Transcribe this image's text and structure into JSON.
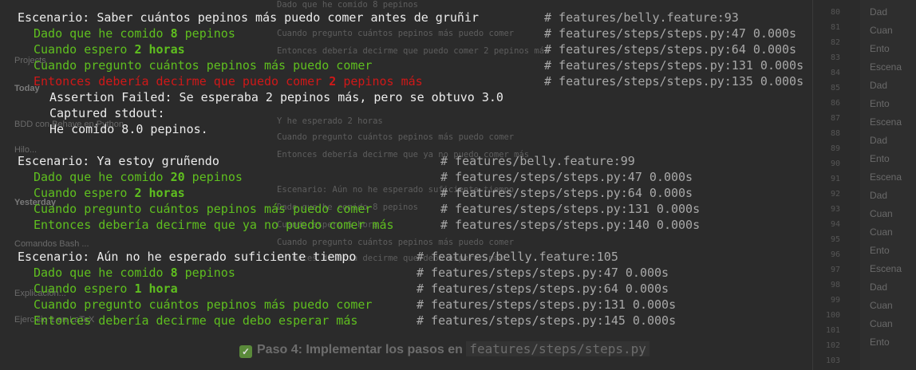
{
  "background": {
    "left_panel": [
      {
        "text": "Projects",
        "bold": false
      },
      {
        "text": "Today",
        "bold": true
      },
      {
        "text": "BDD con Behave en Python",
        "bold": false
      },
      {
        "text": "Hilo...",
        "bold": false
      },
      {
        "text": "Yesterday",
        "bold": true
      },
      {
        "text": "Comandos Bash ...",
        "bold": false
      },
      {
        "text": "Explicación...",
        "bold": false
      },
      {
        "text": "Ejercicio 1 en LaTeX",
        "bold": false
      }
    ],
    "center_lines": [
      "Dado que he comido 8 pepinos",
      "Cuando pregunto cuántos pepinos más puedo comer",
      "Entonces debería decirme que puedo comer 2 pepinos más",
      "Y he esperado 2 horas",
      "Cuando pregunto cuántos pepinos más puedo comer",
      "Entonces debería decirme que ya no puedo comer más",
      "Escenario: Aún no he esperado suficiente tiempo",
      "Dado que he comido 8 pepinos",
      "Cuando espero 1 hora",
      "Cuando pregunto cuántos pepinos más puedo comer",
      "Entonces debería decirme que debo esperar más"
    ],
    "gutter_numbers": [
      "80",
      "81",
      "82",
      "83",
      "84",
      "85",
      "86",
      "87",
      "88",
      "89",
      "90",
      "91",
      "92",
      "93",
      "94",
      "95",
      "96",
      "97",
      "98",
      "99",
      "100",
      "101",
      "102",
      "103"
    ],
    "right_panel": [
      "Dad",
      "Cuan",
      "Ento",
      "Escena",
      "Dad",
      "Ento",
      "Escena",
      "Dad",
      "Ento",
      "Escena",
      "Dad",
      "Cuan",
      "Cuan",
      "Ento",
      "Escena",
      "Dad",
      "Cuan",
      "Cuan",
      "Ento"
    ],
    "heading": {
      "prefix": "Paso 4: Implementar los pasos en ",
      "code": "features/steps/steps.py"
    }
  },
  "scenarios": [
    {
      "title": "Escenario: Saber cuántos pepinos más puedo comer antes de gruñir",
      "location": "# features/belly.feature:93",
      "comment_col": 660,
      "steps": [
        {
          "status": "passed",
          "before": "Dado que he comido ",
          "num": "8",
          "after": " pepinos",
          "location": "# features/steps/steps.py:47 0.000s"
        },
        {
          "status": "passed",
          "before": "Cuando espero ",
          "num": "2 horas",
          "after": "",
          "location": "# features/steps/steps.py:64 0.000s"
        },
        {
          "status": "passed",
          "before": "Cuando pregunto cuántos pepinos más puedo comer",
          "num": "",
          "after": "",
          "location": "# features/steps/steps.py:131 0.000s"
        },
        {
          "status": "failed",
          "before": "Entonces debería decirme que puedo comer ",
          "num": "2",
          "after": " pepinos más",
          "location": "# features/steps/steps.py:135 0.000s"
        }
      ],
      "error_lines": [
        {
          "text": "Assertion Failed: Se esperaba 2 pepinos más, pero se obtuvo 3.0",
          "indent": 4
        },
        {
          "text": "Captured stdout:",
          "indent": 4
        },
        {
          "text": "He comido 8.0 pepinos.",
          "indent": 4
        }
      ]
    },
    {
      "title": "Escenario: Ya estoy gruñendo",
      "location": "# features/belly.feature:99",
      "comment_col": 530,
      "steps": [
        {
          "status": "passed",
          "before": "Dado que he comido ",
          "num": "20",
          "after": " pepinos",
          "location": "# features/steps/steps.py:47 0.000s"
        },
        {
          "status": "passed",
          "before": "Cuando espero ",
          "num": "2 horas",
          "after": "",
          "location": "# features/steps/steps.py:64 0.000s"
        },
        {
          "status": "passed",
          "before": "Cuando pregunto cuántos pepinos más puedo comer",
          "num": "",
          "after": "",
          "location": "# features/steps/steps.py:131 0.000s"
        },
        {
          "status": "passed",
          "before": "Entonces debería decirme que ya no puedo comer más",
          "num": "",
          "after": "",
          "location": "# features/steps/steps.py:140 0.000s"
        }
      ],
      "error_lines": []
    },
    {
      "title": "Escenario: Aún no he esperado suficiente tiempo",
      "location": "# features/belly.feature:105",
      "comment_col": 500,
      "steps": [
        {
          "status": "passed",
          "before": "Dado que he comido ",
          "num": "8",
          "after": " pepinos",
          "location": "# features/steps/steps.py:47 0.000s"
        },
        {
          "status": "passed",
          "before": "Cuando espero ",
          "num": "1 hora",
          "after": "",
          "location": "# features/steps/steps.py:64 0.000s"
        },
        {
          "status": "passed",
          "before": "Cuando pregunto cuántos pepinos más puedo comer",
          "num": "",
          "after": "",
          "location": "# features/steps/steps.py:131 0.000s"
        },
        {
          "status": "passed",
          "before": "Entonces debería decirme que debo esperar más",
          "num": "",
          "after": "",
          "location": "# features/steps/steps.py:145 0.000s"
        }
      ],
      "error_lines": []
    }
  ]
}
